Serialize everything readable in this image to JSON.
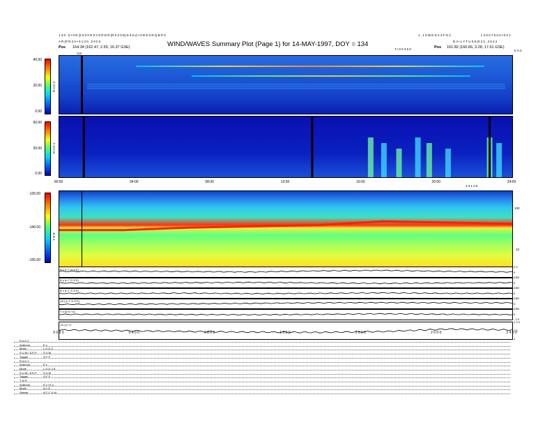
{
  "header": {
    "left_line1": "1 3 0 . 0 • 0 R (2 0 0 0 R P A 0 R D R (R 0 2 0 D) 6 0 0 v) • 0 R E 0 R Q B P C",
    "left_line2": "A R (P R 2 0 • 0 1 3 0 . 0 0 0 3",
    "left_pos_label": "Pos",
    "left_pos_value": "164.34 (162.47, 2.55, 16.37 GSE)",
    "title": "WIND/WAVES Summary Plot (Page 1) for 14-MAY-1997, DOY = 134",
    "right_top_mid": "1 . 1 0 W E D 2 4 F O 2",
    "right_top_far": "L 2 0 0 7 0 0 0 • 0 0 1",
    "right_line2": "D A I L Y  T U 0 8 (0 3 2 . 3 0 4 2",
    "right_pos_label": "Pos",
    "right_pos_value": "161.82 (160.66, 3.28, 17.61 GSE)",
    "mid_label": "T I 0 0 3 5 0",
    "right_unit": "k H 2",
    "cal_label": "Cal"
  },
  "axes": {
    "rad2": {
      "label": "R A D 2",
      "ticks": [
        "40.00",
        "20.00",
        "0.00"
      ]
    },
    "rad1": {
      "label": "R A D 1",
      "ticks": [
        "60.00",
        "30.00",
        "0.00"
      ]
    },
    "tnr": {
      "label": "T N R",
      "ticks": [
        "-125.00",
        "-140.00",
        "-155.00"
      ],
      "right_ticks": [
        "100",
        "10"
      ]
    },
    "mid_time_ticks": [
      "00:00",
      "04:00",
      "08:00",
      "12:00",
      "16:00",
      "20:00",
      "24:00"
    ],
    "mid_time_note": "2 0 1 0 5",
    "bottom_time_ticks": [
      "0 0 0 0",
      "0 4 0 0",
      "0 8 0 0",
      "1 2 0 0",
      "1 6 0 0",
      "2 0 0 0",
      "2 4 0 0"
    ],
    "traces": [
      {
        "label": "B x (n T G S E)",
        "right": [
          "2 0",
          "0",
          "- 2 0"
        ]
      },
      {
        "label": "B y (n T G S E)",
        "right": [
          "2 0",
          "0",
          "- 2 0"
        ]
      },
      {
        "label": "B z (n T G S E)",
        "right": [
          "2 0",
          "0",
          "- 2 0"
        ]
      },
      {
        "label": "| B | (n T G S E)",
        "right": [
          "2 0",
          "0",
          "- 2 0"
        ]
      },
      {
        "label": "V x (k m / s)",
        "right": [
          "2 0",
          "0",
          "- 2 0"
        ]
      },
      {
        "label": "| B | (n T)",
        "right": [
          "1 0 0",
          "1 0",
          "1"
        ]
      }
    ]
  },
  "legend": [
    [
      "R A D 2",
      ""
    ],
    [
      "Antenna",
      "E x"
    ],
    [
      "Mode",
      "L O G 2"
    ],
    [
      "S U M / S E P",
      "S U M"
    ],
    [
      "Toggle",
      "O F F"
    ],
    [
      "R A D 1",
      ""
    ],
    [
      "Antenna",
      "E x"
    ],
    [
      "Mode",
      "L O G 2 8"
    ],
    [
      "S U M / S E P",
      "S U M"
    ],
    [
      "Toggle",
      "O F F"
    ],
    [
      "T N R",
      ""
    ],
    [
      "Antenna",
      "E x / E y"
    ],
    [
      "Mode",
      "A C E"
    ],
    [
      "Sweep",
      "A C C U M"
    ]
  ],
  "chart_data": [
    {
      "type": "heatmap",
      "title": "WIND/WAVES Summary Plot (Page 1) for 14-MAY-1997, DOY = 134",
      "ylabel": "RAD2",
      "ylim": [
        0,
        40
      ],
      "x_ticks": [
        "00:00",
        "04:00",
        "08:00",
        "12:00",
        "16:00",
        "20:00",
        "24:00"
      ],
      "colorscale": [
        "#0000c0",
        "#0060ff",
        "#00d0ff",
        "#40ff80",
        "#ffff00",
        "#ff8000",
        "#ff0000"
      ],
      "bright_bands_hours": [
        [
          5.5,
          22.5
        ]
      ]
    },
    {
      "type": "heatmap",
      "ylabel": "RAD1",
      "ylim": [
        0,
        60
      ],
      "data_gaps_hours": [
        1.3,
        13.4,
        22.8
      ],
      "bursts_hours": [
        16.5,
        17.2,
        18.0,
        19.0,
        19.6,
        20.6,
        22.8,
        23.3
      ]
    },
    {
      "type": "heatmap",
      "ylabel": "TNR",
      "ylim": [
        -155,
        -125
      ],
      "plasma_line_db": [
        -140.5,
        -140.5,
        -139.5,
        -139.0,
        -138.5,
        -137.0,
        -137.5,
        -138.0
      ]
    },
    {
      "type": "line",
      "series": [
        {
          "name": "Bx",
          "values": [
            0.6,
            0.62,
            0.58,
            0.55,
            0.65,
            0.7,
            0.6,
            0.55
          ]
        },
        {
          "name": "By",
          "values": [
            0.5,
            0.48,
            0.52,
            0.55,
            0.5,
            0.45,
            0.5,
            0.52
          ]
        },
        {
          "name": "Bz",
          "values": [
            0.5,
            0.5,
            0.52,
            0.48,
            0.5,
            0.55,
            0.5,
            0.5
          ]
        },
        {
          "name": "|B|",
          "values": [
            0.45,
            0.47,
            0.5,
            0.55,
            0.6,
            0.62,
            0.6,
            0.6
          ]
        },
        {
          "name": "Vx",
          "values": [
            0.5,
            0.5,
            0.48,
            0.46,
            0.5,
            0.55,
            0.5,
            0.48
          ]
        },
        {
          "name": "|B| nT",
          "values": [
            0.55,
            0.5,
            0.45,
            0.42,
            0.4,
            0.45,
            0.6,
            0.55
          ]
        }
      ]
    }
  ]
}
